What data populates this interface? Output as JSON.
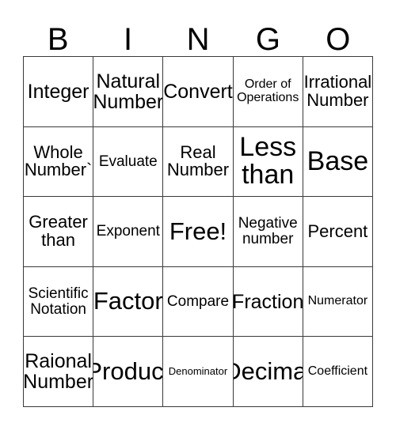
{
  "card": {
    "title": "BINGO",
    "background_color": "#ffffff",
    "text_color": "#000000",
    "border_color": "#3a3a3a"
  },
  "header": {
    "letters": [
      "B",
      "I",
      "N",
      "G",
      "O"
    ]
  },
  "grid": {
    "rows": 5,
    "columns": 5,
    "free_space": {
      "row": 3,
      "column": 3,
      "label": "Free!"
    },
    "cells": [
      [
        {
          "label": "Integer",
          "size": "xl"
        },
        {
          "label": "Natural\nNumber",
          "size": "xl"
        },
        {
          "label": "Convert",
          "size": "xl"
        },
        {
          "label": "Order of\nOperations",
          "size": "s"
        },
        {
          "label": "Irrational\nNumber",
          "size": "l"
        }
      ],
      [
        {
          "label": "Whole\nNumber`",
          "size": "l"
        },
        {
          "label": "Evaluate",
          "size": "m"
        },
        {
          "label": "Real\nNumber",
          "size": "l"
        },
        {
          "label": "Less\nthan",
          "size": "huge"
        },
        {
          "label": "Base",
          "size": "huge"
        }
      ],
      [
        {
          "label": "Greater\nthan",
          "size": "l"
        },
        {
          "label": "Exponent",
          "size": "m"
        },
        {
          "label": "Free!",
          "size": "xxl"
        },
        {
          "label": "Negative\nnumber",
          "size": "m"
        },
        {
          "label": "Percent",
          "size": "l"
        }
      ],
      [
        {
          "label": "Scientific\nNotation",
          "size": "m"
        },
        {
          "label": "Factor",
          "size": "xxl"
        },
        {
          "label": "Compare",
          "size": "m"
        },
        {
          "label": "Fraction",
          "size": "xl"
        },
        {
          "label": "Numerator",
          "size": "s"
        }
      ],
      [
        {
          "label": "Raional\nNumber",
          "size": "xl"
        },
        {
          "label": "Product",
          "size": "xxl"
        },
        {
          "label": "Denominator",
          "size": "xs"
        },
        {
          "label": "Decimal",
          "size": "xxl"
        },
        {
          "label": "Coefficient",
          "size": "s"
        }
      ]
    ]
  }
}
